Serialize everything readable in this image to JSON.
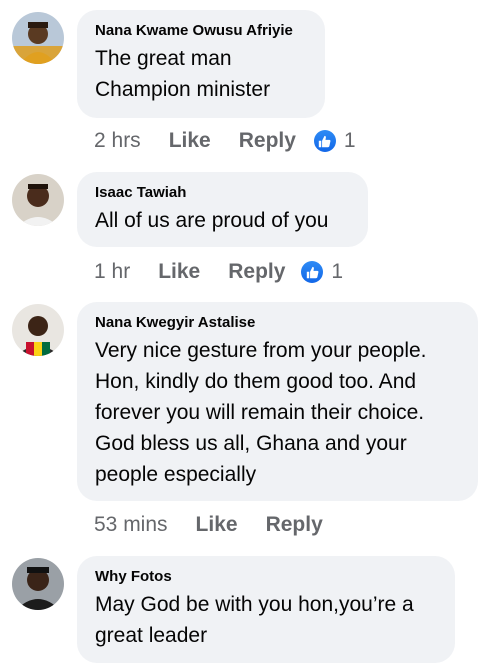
{
  "comments": [
    {
      "author": "Nana Kwame Owusu Afriyie",
      "lines": [
        "The great man",
        "Champion minister"
      ],
      "time": "2 hrs",
      "like_label": "Like",
      "reply_label": "Reply",
      "reactions": "1"
    },
    {
      "author": "Isaac Tawiah",
      "lines": [
        "All of us are proud of you"
      ],
      "time": "1 hr",
      "like_label": "Like",
      "reply_label": "Reply",
      "reactions": "1"
    },
    {
      "author": "Nana Kwegyir Astalise",
      "lines": [
        "Very nice gesture from your people.",
        "Hon, kindly do them good too. And",
        "forever you will remain their choice.",
        "God bless us all, Ghana and your",
        "people especially"
      ],
      "time": "53 mins",
      "like_label": "Like",
      "reply_label": "Reply"
    },
    {
      "author": "Why Fotos",
      "lines": [
        "May God be with you hon,you’re a",
        "great leader"
      ]
    }
  ],
  "colors": {
    "bubble": "#f0f2f5",
    "meta_text": "#65676b",
    "like_blue": "#1877f2"
  },
  "icons": {
    "reaction": "thumbs-up-icon"
  }
}
